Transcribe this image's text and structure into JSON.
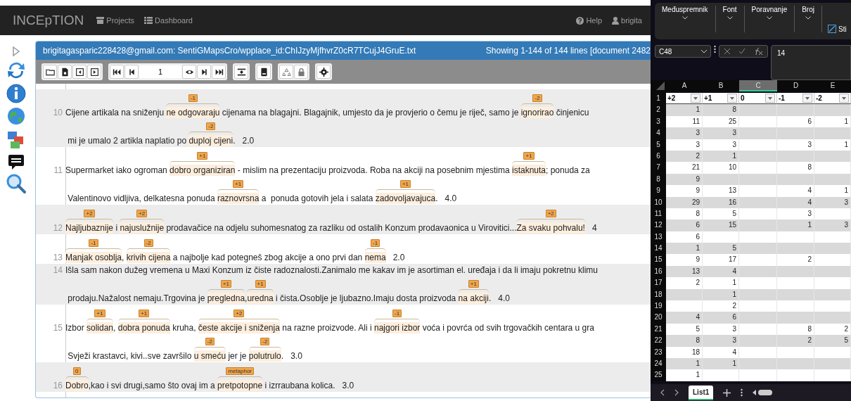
{
  "app": {
    "brand": "INCEpTION",
    "nav": [
      "Projects",
      "Dashboard"
    ],
    "help": "Help",
    "user": "brigita"
  },
  "document": {
    "title": "brigitagasparic228428@gmail.com: SentiGMapsCro/wpplace_id:ChIJzyMjfhvrZ0cR7TCujJ4GruE.txt",
    "status": "Showing 1-144 of 144 lines [document 2482",
    "page": "1"
  },
  "rows": [
    {
      "number": "10",
      "lines": [
        [
          {
            "text": "Cijene artikala na sniženju "
          },
          {
            "text": "ne odgovaraju",
            "label": "-1"
          },
          {
            "text": " cijenama na blagajni. Blagajnik, umjesto da je provjerio o čemu je riječ, samo je "
          },
          {
            "text": "ignorirao",
            "label": "-2"
          },
          {
            "text": " činjenicu"
          }
        ],
        [
          {
            "text": " mi je umalo 2 artikla naplatio po "
          },
          {
            "text": "duploj cijeni",
            "label": "-2"
          },
          {
            "text": ".   2.0"
          }
        ]
      ]
    },
    {
      "number": "11",
      "lines": [
        [
          {
            "text": "Supermarket iako ogroman "
          },
          {
            "text": "dobro organiziran",
            "label": "+1"
          },
          {
            "text": " - mislim na prezentaciju proizvoda. Roba na akciji na posebnim mjestima "
          },
          {
            "text": "istaknuta",
            "label": "+1"
          },
          {
            "text": "; ponuda za"
          }
        ],
        [
          {
            "text": " Valentinovo vidljiva, delkatesna ponuda "
          },
          {
            "text": "raznovrsna",
            "label": "+1"
          },
          {
            "text": " a  ponuda gotovih jela i salata "
          },
          {
            "text": "zadovoljavajuca",
            "label": "+1"
          },
          {
            "text": ".   4.0"
          }
        ]
      ]
    },
    {
      "number": "12",
      "lines": [
        [
          {
            "text": "Najljubaznije",
            "label": "+2"
          },
          {
            "text": " i "
          },
          {
            "text": "najuslužnije",
            "label": "+2"
          },
          {
            "text": " prodavačice na odjelu suhomesnatog za razliku od ostalih Konzum prodavaonica u Virovitici..."
          },
          {
            "text": "Za svaku pohvalu!",
            "label": "+2"
          },
          {
            "text": "   4"
          }
        ]
      ]
    },
    {
      "number": "13",
      "lines": [
        [
          {
            "text": "Manjak osoblja",
            "label": "-1"
          },
          {
            "text": ", "
          },
          {
            "text": "krivih cijena",
            "label": "-2"
          },
          {
            "text": " a najbolje kad potegneš zbog akcije a ono prvi dan "
          },
          {
            "text": "nema",
            "label": "-1"
          },
          {
            "text": "   2.0"
          }
        ]
      ]
    },
    {
      "number": "14",
      "lines": [
        [
          {
            "text": "Išla sam nakon dužeg vremena u Maxi Konzum iz čiste radoznalosti.Zanimalo me kakav im je asortiman el. uređaja i da li imaju pokretnu klimu"
          }
        ],
        [
          {
            "text": " prodaju.Nažalost nemaju.Trgovina je "
          },
          {
            "text": "pregledna",
            "label": "+1"
          },
          {
            "text": ","
          },
          {
            "text": "uredna",
            "label": "+1"
          },
          {
            "text": " i čista.Osoblje je ljubazno.Imaju dosta proizvoda "
          },
          {
            "text": "na akciji",
            "label": "+1"
          },
          {
            "text": ".   4.0"
          }
        ]
      ]
    },
    {
      "number": "15",
      "lines": [
        [
          {
            "text": "Izbor "
          },
          {
            "text": "solidan",
            "label": "+1"
          },
          {
            "text": ", "
          },
          {
            "text": "dobra ponuda",
            "label": "+1"
          },
          {
            "text": " kruha, "
          },
          {
            "text": "česte akcije i sniženja",
            "label": "+2"
          },
          {
            "text": " na razne proizvode. Ali i "
          },
          {
            "text": "najgori izbor",
            "label": "-1"
          },
          {
            "text": " voća i povrća od svih trgovačkih centara u gra"
          }
        ],
        [
          {
            "text": " Svježi krastavci, kivi..sve završilo "
          },
          {
            "text": "u smeću",
            "label": "-2"
          },
          {
            "text": " jer je "
          },
          {
            "text": "polutrulo",
            "label": "-2"
          },
          {
            "text": ".   3.0"
          }
        ]
      ]
    },
    {
      "number": "16",
      "lines": [
        [
          {
            "text": "Dobro",
            "label": "0"
          },
          {
            "text": ",kao i svi drugi,samo što ovaj im a "
          },
          {
            "text": "pretpotopne",
            "label": "metaphor"
          },
          {
            "text": " i izrraubana kolica.   3.0"
          }
        ]
      ]
    }
  ],
  "sheet": {
    "ribbon": [
      "Međuspremnik",
      "Font",
      "Poravnanje",
      "Broj"
    ],
    "styles": "Sti",
    "name_box": "C48",
    "formula": "14",
    "columns": [
      {
        "label": "A",
        "selected": false
      },
      {
        "label": "B",
        "selected": false
      },
      {
        "label": "C",
        "selected": true
      },
      {
        "label": "D",
        "selected": false
      },
      {
        "label": "E",
        "selected": false
      }
    ],
    "header_row": {
      "number": "1",
      "cells": [
        "+2",
        "+1",
        "0",
        "-1",
        "-2"
      ]
    },
    "rows": [
      {
        "number": "2",
        "a": "1",
        "b": "8"
      },
      {
        "number": "3",
        "a": "11",
        "b": "25",
        "d": "6",
        "e": "1"
      },
      {
        "number": "4",
        "a": "3",
        "b": "3"
      },
      {
        "number": "5",
        "a": "3",
        "b": "3",
        "d": "3",
        "e": "1"
      },
      {
        "number": "6",
        "a": "2",
        "b": "1"
      },
      {
        "number": "7",
        "a": "21",
        "b": "10",
        "d": "8"
      },
      {
        "number": "8",
        "a": "9"
      },
      {
        "number": "9",
        "a": "9",
        "b": "13",
        "d": "4",
        "e": "1"
      },
      {
        "number": "10",
        "a": "29",
        "b": "16",
        "d": "4",
        "e": "3"
      },
      {
        "number": "11",
        "a": "8",
        "b": "5",
        "d": "3"
      },
      {
        "number": "12",
        "a": "6",
        "b": "15",
        "d": "1",
        "e": "3"
      },
      {
        "number": "13",
        "a": "6"
      },
      {
        "number": "14",
        "a": "1",
        "b": "5"
      },
      {
        "number": "15",
        "a": "9",
        "b": "17",
        "d": "2"
      },
      {
        "number": "16",
        "a": "13",
        "b": "4"
      },
      {
        "number": "17",
        "a": "2",
        "b": "1"
      },
      {
        "number": "18",
        "b": "1"
      },
      {
        "number": "19",
        "b": "2"
      },
      {
        "number": "20",
        "a": "4",
        "b": "6"
      },
      {
        "number": "21",
        "a": "5",
        "b": "3",
        "d": "8",
        "e": "2"
      },
      {
        "number": "22",
        "a": "8",
        "b": "3",
        "d": "2",
        "e": "5"
      },
      {
        "number": "23",
        "a": "18",
        "b": "4"
      },
      {
        "number": "24",
        "a": "1",
        "b": "1"
      },
      {
        "number": "25",
        "a": "1"
      }
    ],
    "tabs": [
      {
        "label": "List1",
        "selected": true
      }
    ]
  }
}
